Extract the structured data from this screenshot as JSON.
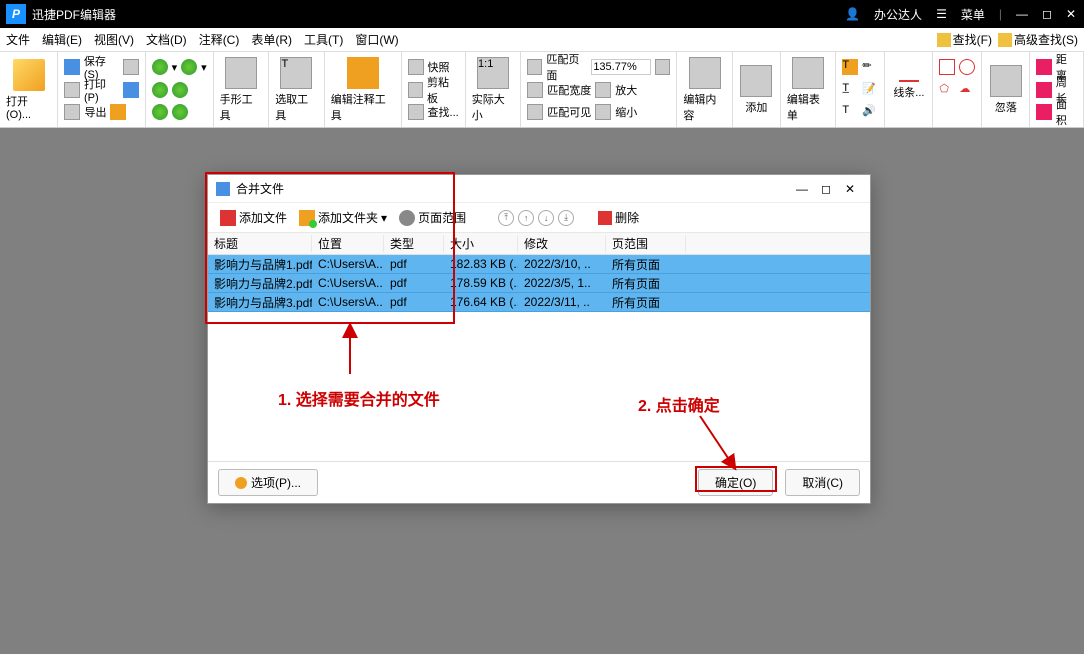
{
  "titlebar": {
    "app_name": "迅捷PDF编辑器",
    "user": "办公达人",
    "menu_btn": "菜单"
  },
  "menubar": {
    "items": [
      "文件",
      "编辑(E)",
      "视图(V)",
      "文档(D)",
      "注释(C)",
      "表单(R)",
      "工具(T)",
      "窗口(W)"
    ],
    "right": {
      "find": "查找(F)",
      "adv_find": "高级查找(S)"
    }
  },
  "ribbon": {
    "open": "打开(O)...",
    "rows": {
      "save": "保存(S)",
      "print": "打印(P)",
      "export": "导出"
    },
    "hand": "手形工具",
    "select": "选取工具",
    "edit_anno": "编辑注释工具",
    "snap": "快照",
    "clipboard": "剪粘板",
    "find": "查找...",
    "actual": "实际大小",
    "fit_page": "匹配页面",
    "fit_width": "匹配宽度",
    "fit_visible": "匹配可见",
    "zoom": "135.77%",
    "zoomin": "放大",
    "zoomout": "缩小",
    "edit_content": "编辑内容",
    "add": "添加",
    "edit_form": "编辑表单",
    "line": "线条...",
    "ignore": "忽落",
    "dist": "距离",
    "perim": "周长",
    "area": "面积"
  },
  "dialog": {
    "title": "合并文件",
    "toolbar": {
      "add_file": "添加文件",
      "add_folder": "添加文件夹",
      "page_range": "页面范围",
      "delete": "删除"
    },
    "headers": {
      "title": "标题",
      "location": "位置",
      "type": "类型",
      "size": "大小",
      "modified": "修改",
      "range": "页范围"
    },
    "rows": [
      {
        "title": "影响力与品牌1.pdf",
        "loc": "C:\\Users\\A..",
        "type": "pdf",
        "size": "182.83 KB (..",
        "mod": "2022/3/10, ..",
        "range": "所有页面"
      },
      {
        "title": "影响力与品牌2.pdf",
        "loc": "C:\\Users\\A..",
        "type": "pdf",
        "size": "178.59 KB (..",
        "mod": "2022/3/5, 1..",
        "range": "所有页面"
      },
      {
        "title": "影响力与品牌3.pdf",
        "loc": "C:\\Users\\A..",
        "type": "pdf",
        "size": "176.64 KB (..",
        "mod": "2022/3/11, ..",
        "range": "所有页面"
      }
    ],
    "footer": {
      "options": "选项(P)...",
      "ok": "确定(O)",
      "cancel": "取消(C)"
    }
  },
  "annotations": {
    "step1": "1. 选择需要合并的文件",
    "step2": "2. 点击确定"
  }
}
